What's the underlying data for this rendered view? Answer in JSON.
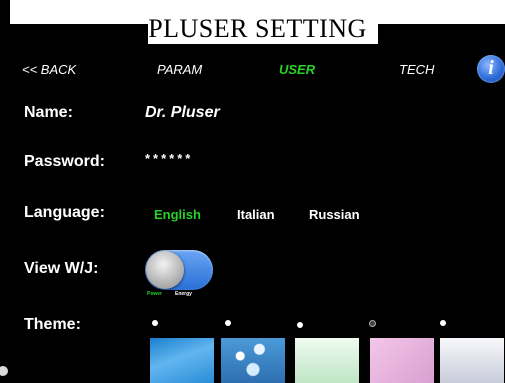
{
  "title": "PLUSER SETTING",
  "nav": {
    "back": "<< BACK",
    "param": "PARAM",
    "user": "USER",
    "tech": "TECH",
    "info_icon": "i"
  },
  "fields": {
    "name_label": "Name:",
    "name_value": "Dr. Pluser",
    "password_label": "Password:",
    "password_value": "******",
    "language_label": "Language:",
    "languages": [
      "English",
      "Italian",
      "Russian"
    ],
    "selected_language": "English",
    "view_label": "View W/J:",
    "toggle_left": "Power",
    "toggle_right": "Energy",
    "theme_label": "Theme:"
  },
  "themes": {
    "selected_index": 3,
    "colors": [
      "#3a9ae0",
      "#4b9ad7",
      "#d4f0d8",
      "#e8b6e0",
      "#e2e4ee"
    ]
  },
  "accent": "#27d127"
}
